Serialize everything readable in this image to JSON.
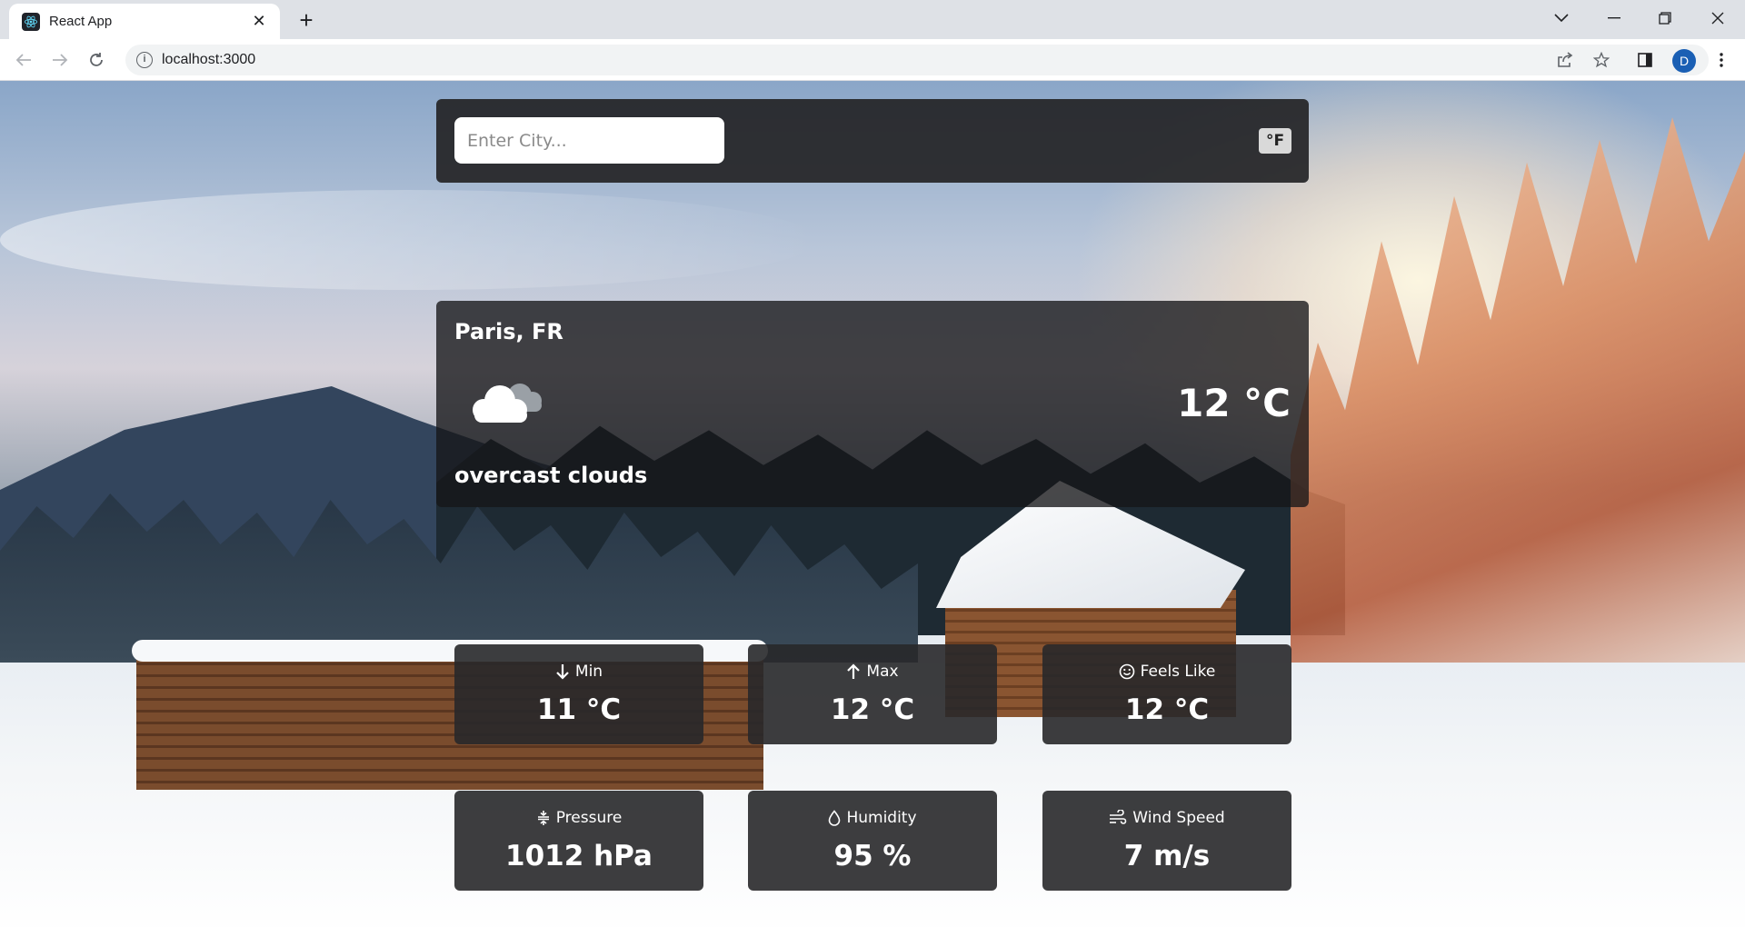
{
  "browser": {
    "tab_title": "React App",
    "tab_close": "✕",
    "new_tab": "+",
    "url": "localhost:3000",
    "profile_initial": "D"
  },
  "search": {
    "placeholder": "Enter City...",
    "value": "",
    "unit_toggle_label": "°F"
  },
  "current": {
    "location": "Paris, FR",
    "temperature": "12 °C",
    "description": "overcast clouds",
    "icon": "overcast-clouds-icon"
  },
  "stats": [
    {
      "label": "Min",
      "value": "11 °C",
      "icon": "arrow-down-icon"
    },
    {
      "label": "Max",
      "value": "12 °C",
      "icon": "arrow-up-icon"
    },
    {
      "label": "Feels Like",
      "value": "12 °C",
      "icon": "smile-icon"
    },
    {
      "label": "Pressure",
      "value": "1012 hPa",
      "icon": "compress-icon"
    },
    {
      "label": "Humidity",
      "value": "95 %",
      "icon": "droplet-icon"
    },
    {
      "label": "Wind Speed",
      "value": "7 m/s",
      "icon": "wind-icon"
    }
  ],
  "colors": {
    "panel_bg": "#252527",
    "card_bg": "#161618",
    "text": "#ffffff",
    "toggle_bg": "#d9d9d9",
    "avatar": "#1a5fb4"
  }
}
